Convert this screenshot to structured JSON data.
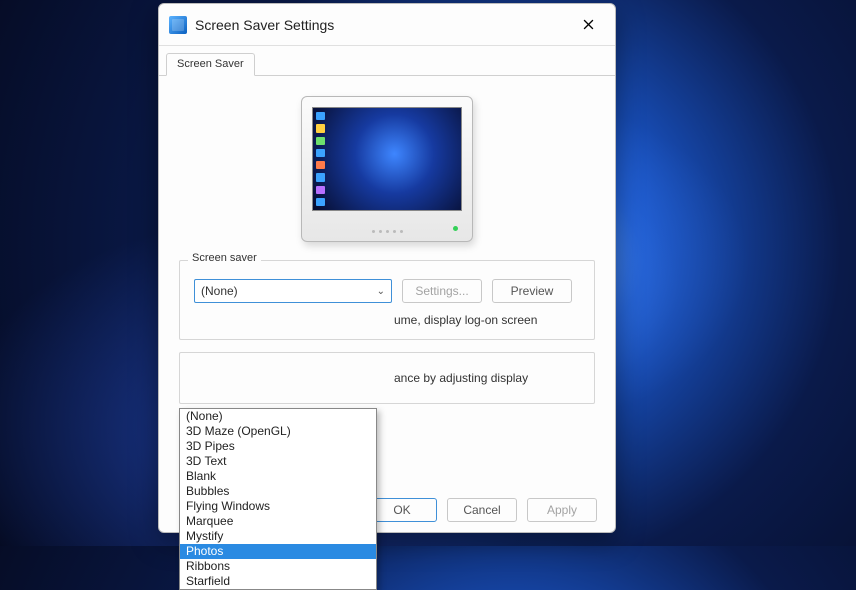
{
  "titlebar": {
    "title": "Screen Saver Settings"
  },
  "tabs": [
    {
      "label": "Screen Saver"
    }
  ],
  "screensaver_group": {
    "label": "Screen saver",
    "combo_selected": "(None)",
    "settings_label": "Settings...",
    "preview_label": "Preview",
    "resume_text": "ume, display log-on screen"
  },
  "power_group": {
    "text_fragment": "ance by adjusting display"
  },
  "dropdown": {
    "options": [
      "(None)",
      "3D Maze (OpenGL)",
      "3D Pipes",
      "3D Text",
      "Blank",
      "Bubbles",
      "Flying Windows",
      "Marquee",
      "Mystify",
      "Photos",
      "Ribbons",
      "Starfield"
    ],
    "highlighted": "Photos"
  },
  "footer": {
    "ok": "OK",
    "cancel": "Cancel",
    "apply": "Apply"
  }
}
